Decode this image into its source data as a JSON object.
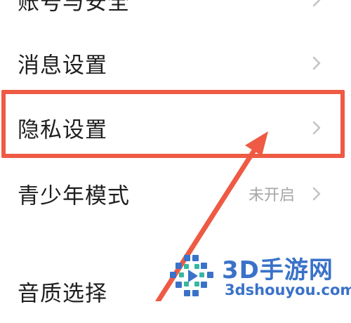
{
  "settings": {
    "items": [
      {
        "label": "账号与安全",
        "value": ""
      },
      {
        "label": "消息设置",
        "value": ""
      },
      {
        "label": "隐私设置",
        "value": ""
      },
      {
        "label": "青少年模式",
        "value": "未开启"
      },
      {
        "label": "音质选择",
        "value": ""
      }
    ],
    "chevron_icon": "chevron-right-icon"
  },
  "annotation": {
    "highlight_color": "#ee5a44",
    "arrow_color": "#ee5a44",
    "highlighted_item": "隐私设置"
  },
  "watermark": {
    "title": "3D手游网",
    "url": "3dshouyou.com",
    "color": "#3a72c8"
  },
  "colors": {
    "background": "#ffffff",
    "text": "#1f1f1f",
    "secondary_text": "#a6a6a6",
    "chevron": "#c4c4c4"
  }
}
